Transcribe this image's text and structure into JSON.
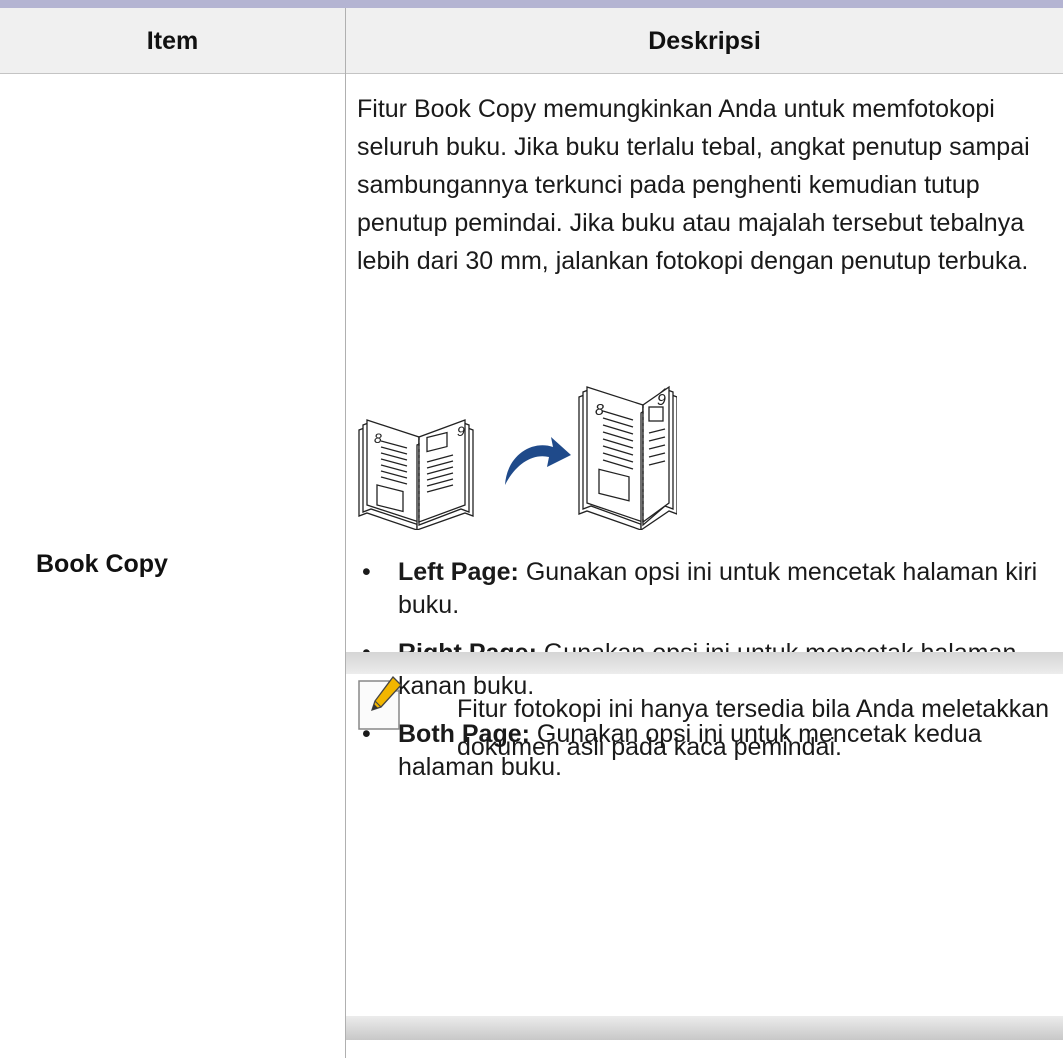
{
  "table": {
    "headers": {
      "item": "Item",
      "description": "Deskripsi"
    },
    "row": {
      "item": "Book Copy",
      "description": "Fitur Book Copy memungkinkan Anda untuk memfotokopi seluruh buku. Jika buku terlalu tebal, angkat penutup sampai sambungannya terkunci pada penghenti kemudian tutup penutup pemindai. Jika buku atau majalah tersebut tebalnya lebih dari 30 mm, jalankan fotokopi dengan penutup terbuka.",
      "illustration": {
        "left_book_numbers": [
          "8",
          "9"
        ],
        "right_book_numbers": [
          "8",
          "9"
        ]
      },
      "options": [
        {
          "bullet": "•",
          "label": "Left Page:",
          "text": "Gunakan opsi ini untuk mencetak halaman kiri buku."
        },
        {
          "bullet": "•",
          "label": "Right Page:",
          "text": "Gunakan opsi ini untuk mencetak halaman kanan buku."
        },
        {
          "bullet": "•",
          "label": "Both Page:",
          "text": "Gunakan opsi ini untuk mencetak kedua halaman buku."
        }
      ],
      "note": {
        "icon": "note-pencil-icon",
        "text": "Fitur fotokopi ini hanya tersedia bila Anda meletakkan dokumen asli pada kaca pemindai."
      }
    }
  },
  "colors": {
    "top_rule": "#b4b4d2",
    "header_bg": "#f0f0f0",
    "arrow": "#1f4a8a",
    "note_icon_accent": "#f2b600"
  }
}
